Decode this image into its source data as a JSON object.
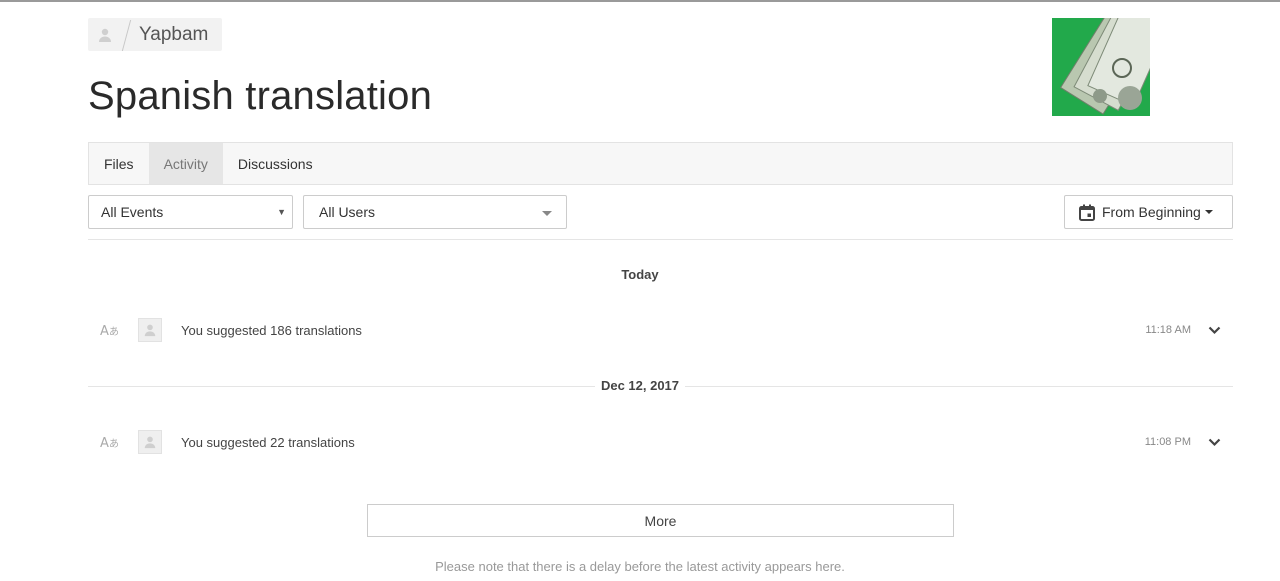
{
  "breadcrumb": {
    "project": "Yapbam"
  },
  "page": {
    "title": "Spanish translation"
  },
  "tabs": [
    {
      "label": "Files",
      "active": false
    },
    {
      "label": "Activity",
      "active": true
    },
    {
      "label": "Discussions",
      "active": false
    }
  ],
  "filters": {
    "events": {
      "value": "All Events"
    },
    "users": {
      "value": "All Users"
    },
    "date": {
      "label": "From Beginning",
      "icon": "calendar-icon"
    }
  },
  "activity": [
    {
      "date_label": "Today",
      "items": [
        {
          "icon": "translate-icon",
          "text": "You suggested 186 translations",
          "time": "11:18 AM"
        }
      ]
    },
    {
      "date_label": "Dec 12, 2017",
      "items": [
        {
          "icon": "translate-icon",
          "text": "You suggested 22 translations",
          "time": "11:08 PM"
        }
      ]
    }
  ],
  "more_label": "More",
  "note": "Please note that there is a delay before the latest activity appears here.",
  "colors": {
    "logo_green": "#22a94b",
    "tab_active_bg": "#e6e6e6",
    "border": "#cccccc"
  }
}
